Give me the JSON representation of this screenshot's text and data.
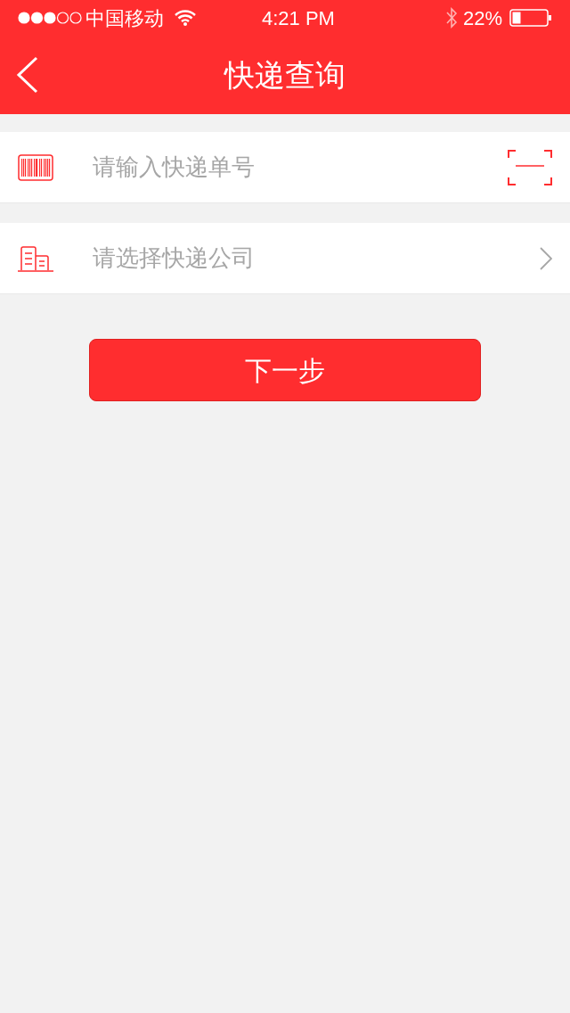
{
  "status_bar": {
    "carrier": "中国移动",
    "time": "4:21 PM",
    "battery": "22%"
  },
  "nav": {
    "title": "快递查询"
  },
  "form": {
    "tracking_field": {
      "placeholder": "请输入快递单号"
    },
    "company_select": {
      "placeholder": "请选择快递公司"
    }
  },
  "next_button": "下一步"
}
